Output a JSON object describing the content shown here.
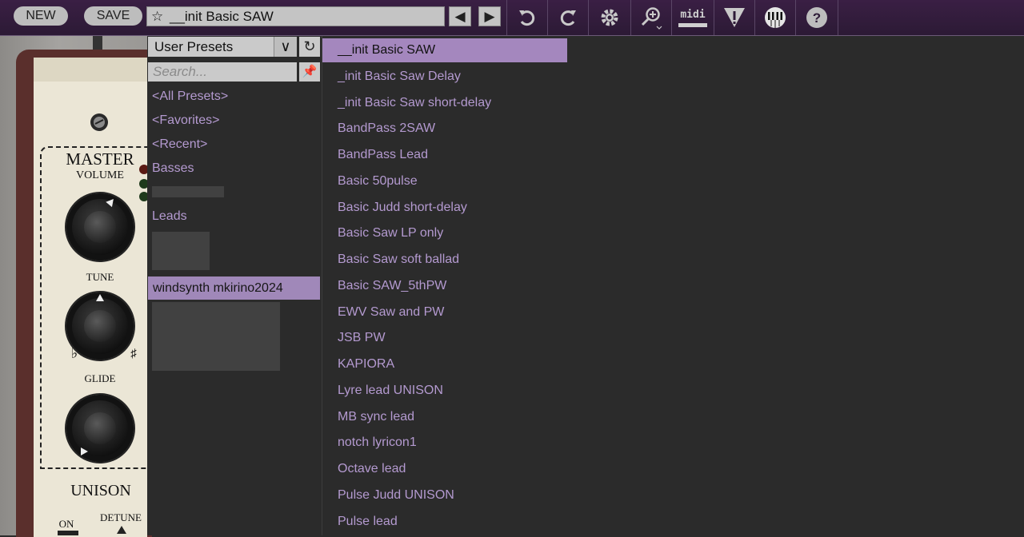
{
  "toolbar": {
    "new_label": "NEW",
    "save_label": "SAVE",
    "current_preset": "__init Basic SAW",
    "midi_label": "midi",
    "icons": [
      "star-icon",
      "arrow-left-icon",
      "arrow-right-icon",
      "undo-icon",
      "redo-icon",
      "gear-icon",
      "zoom-icon",
      "midi-icon",
      "warning-icon",
      "keyboard-icon",
      "help-icon"
    ]
  },
  "synth": {
    "master_label": "MASTER",
    "volume_label": "VOLUME",
    "tune_label": "TUNE",
    "glide_label": "GLIDE",
    "unison_label": "UNISON",
    "on_label": "ON",
    "detune_label": "DETUNE",
    "flat_symbol": "♭",
    "sharp_symbol": "♯"
  },
  "browser": {
    "library": "User Presets",
    "search_placeholder": "Search...",
    "categories": [
      "<All Presets>",
      "<Favorites>",
      "<Recent>",
      "Basses",
      "Leads"
    ],
    "selected_category": "windsynth mkirino2024",
    "presets": [
      "__init Basic SAW",
      "_init Basic Saw Delay",
      "_init Basic Saw short-delay",
      "BandPass 2SAW",
      "BandPass Lead",
      "Basic 50pulse",
      "Basic Judd short-delay",
      "Basic Saw LP only",
      "Basic Saw soft ballad",
      "Basic SAW_5thPW",
      "EWV Saw and PW",
      "JSB PW",
      "KAPIORA",
      "Lyre lead UNISON",
      "MB sync lead",
      "notch lyricon1",
      "Octave lead",
      "Pulse Judd UNISON",
      "Pulse lead"
    ]
  }
}
